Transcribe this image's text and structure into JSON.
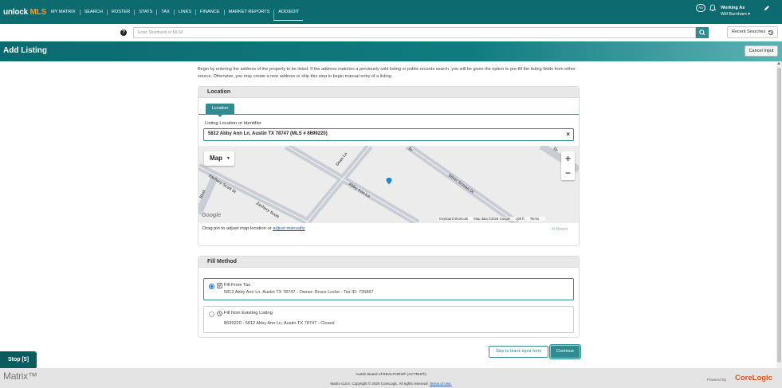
{
  "app": {
    "logo_main": "unlock",
    "logo_accent": "MLS",
    "nav": [
      "MY MATRIX",
      "SEARCH",
      "ROSTER",
      "STATS",
      "TAX",
      "LINKS",
      "FINANCE",
      "MARKET REPORTS",
      "ADD/EDIT"
    ],
    "nav_active": "ADD/EDIT",
    "text_size_label": "Aa",
    "working_as_label": "Working As",
    "user_name": "Will Burnham ▾",
    "brand_color": "#0d6b70",
    "accent_color": "#2e8b8f"
  },
  "search": {
    "help_label": "?",
    "placeholder": "Enter Shorthand or MLS#",
    "recent_label": "Recent Searches"
  },
  "header": {
    "title": "Add Listing",
    "cancel_label": "Cancel Input"
  },
  "intro": "Begin by entering the address of the property to be listed. If the address matches a previously sold listing or public records search, you will be given the option to pre-fill the listing fields from either source. Otherwise, you may create a new address or skip this step to begin manual entry of a listing.",
  "location": {
    "section_title": "Location",
    "tab_label": "Location",
    "field_label": "Listing Location or Identifier",
    "field_value": "5812 Abby Ann Ln, Austin TX 78747 (MLS # 8699220)",
    "clear_label": "×",
    "map": {
      "type_label": "Map",
      "zoom_in": "+",
      "zoom_out": "−",
      "google_mark": "Google",
      "keyboard_shortcuts": "Keyboard shortcuts",
      "map_data": "Map data ©2025 Google",
      "scale": "100 ft",
      "terms": "Terms",
      "streets": [
        "Zachary Scott St",
        "Zachary Scott",
        "Abby Ann Ln",
        "Silver Screen Dr",
        "Dean Ln",
        "Blvd",
        "Dr",
        "Dr"
      ]
    },
    "drag_text": "Drag pin to adjust map location or ",
    "drag_link": "adjust manually",
    "revert_label": "Revert"
  },
  "fill_method": {
    "section_title": "Fill Method",
    "options": [
      {
        "title": "Fill From Tax",
        "detail": "5812 Abby Ann Ln, Austin TX 78747 - Owner: Bruce Locke - Tax ID: 735867",
        "selected": true
      },
      {
        "title": "Fill from Existing Listing",
        "detail": "8699220 - 5812 Abby Ann Ln, Austin TX 78747 - Closed",
        "selected": false
      }
    ]
  },
  "actions": {
    "skip_label": "Skip to blank input form",
    "continue_label": "Continue",
    "stop_label": "Stop [5]"
  },
  "footer": {
    "logo": "Matrix™",
    "board": "Austin Board of REALTORS® (ACTRIS®)",
    "copyright": "Matrix v12.5. Copyright © 2025 CoreLogic. All rights reserved. ",
    "terms_link": "Terms of Use.",
    "powered_by": "Powered By",
    "corelogic": "CoreLogic"
  }
}
